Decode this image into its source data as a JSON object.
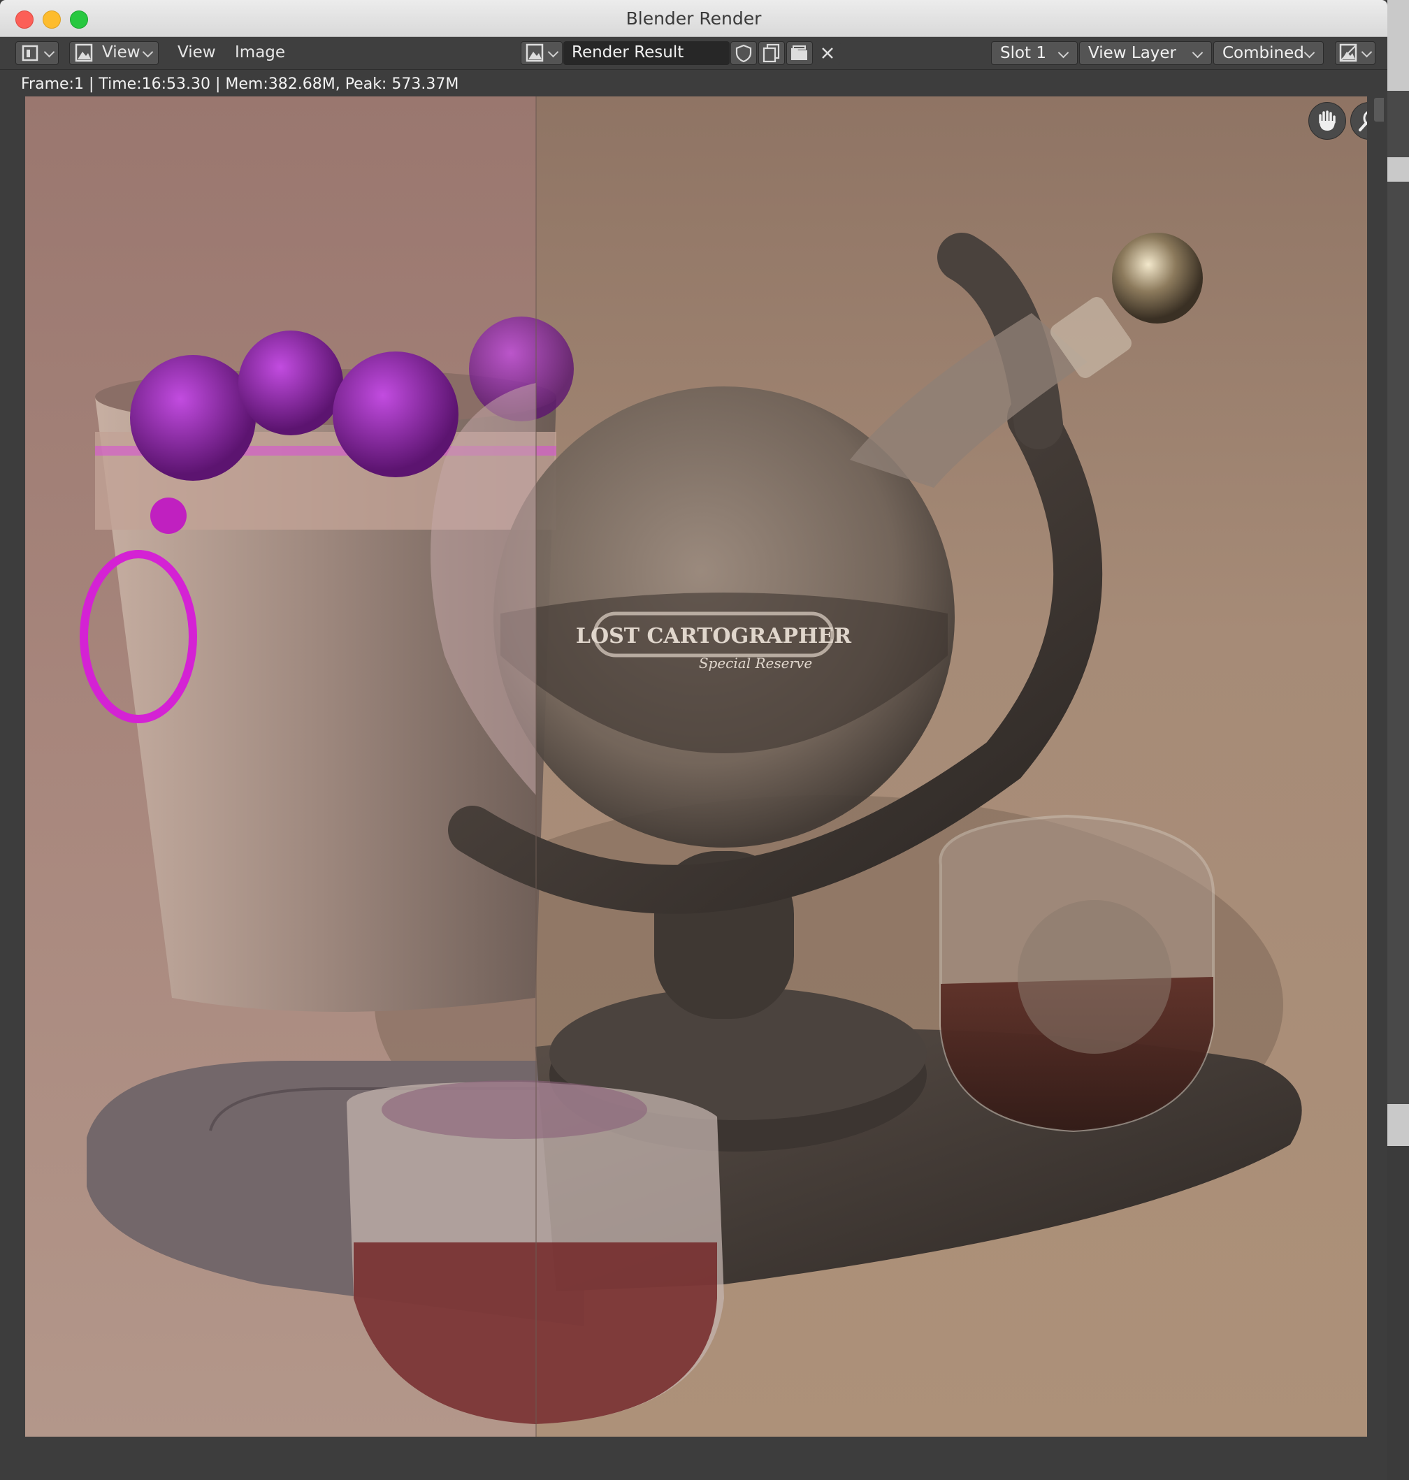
{
  "window": {
    "title": "Blender Render"
  },
  "header": {
    "menus": {
      "view_primary": "View",
      "view": "View",
      "image": "Image"
    },
    "image_name": "Render Result",
    "slot": "Slot 1",
    "view_layer": "View Layer",
    "pass": "Combined"
  },
  "info": {
    "status": "Frame:1 | Time:16:53.30 | Mem:382.68M, Peak: 573.37M"
  },
  "render": {
    "label_text": "LOST CARTOGRAPHER",
    "label_subtext": "Special Reserve"
  },
  "colors": {
    "header_bg": "#3f3f3f",
    "field_bg": "#272727",
    "button_bg": "#545454",
    "missing_texture": "#e01ee0"
  },
  "icons": {
    "editor_type": "image-editor-icon",
    "mode": "view-mode-icon",
    "browse": "browse-image-icon",
    "fake_user": "shield-icon",
    "new_image": "new-image-icon",
    "open_image": "folder-icon",
    "unlink": "close-icon",
    "display_channels": "display-channels-icon",
    "pan": "hand-icon",
    "zoom": "zoom-icon"
  }
}
